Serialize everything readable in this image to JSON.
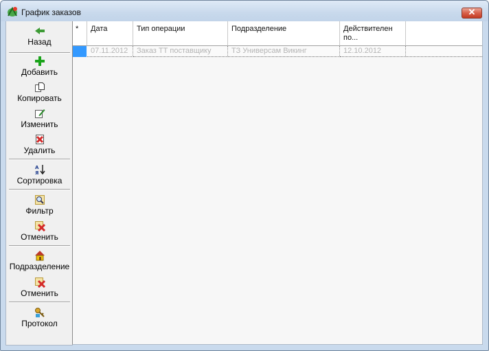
{
  "window": {
    "title": "График заказов",
    "accent": "#3399ff"
  },
  "toolbar": [
    {
      "label": "Назад",
      "icon": "back-arrow-icon"
    },
    {
      "label": "Добавить",
      "icon": "plus-icon"
    },
    {
      "label": "Копировать",
      "icon": "copy-icon"
    },
    {
      "label": "Изменить",
      "icon": "edit-icon"
    },
    {
      "label": "Удалить",
      "icon": "delete-icon"
    },
    {
      "label": "Сортировка",
      "icon": "sort-icon"
    },
    {
      "label": "Фильтр",
      "icon": "filter-icon"
    },
    {
      "label": "Отменить",
      "icon": "cancel-icon"
    },
    {
      "label": "Подразделение",
      "icon": "house-icon"
    },
    {
      "label": "Отменить",
      "icon": "cancel-icon"
    },
    {
      "label": "Протокол",
      "icon": "protocol-icon"
    }
  ],
  "grid": {
    "columns": [
      "*",
      "Дата",
      "Тип операции",
      "Подразделение",
      "Действителен по..."
    ],
    "rows": [
      [
        "",
        "07.11.2012",
        "Заказ ТТ поставщику",
        "ТЗ Универсам Викинг",
        "12.10.2012"
      ]
    ]
  }
}
